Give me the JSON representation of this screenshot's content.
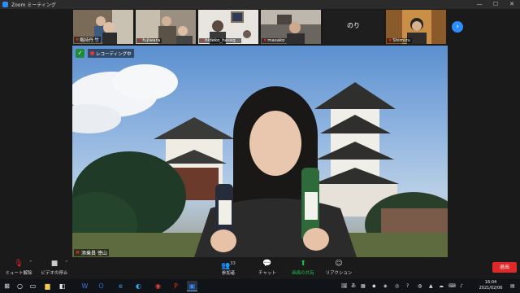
{
  "window": {
    "title": "Zoom ミーティング",
    "controls": {
      "minimize": "—",
      "maximize": "☐",
      "close": "✕"
    }
  },
  "thumbnails": [
    {
      "name": "剱持丹 竹",
      "muted": true
    },
    {
      "name": "fujiwara",
      "muted": true
    },
    {
      "name": "hideko_haseg...",
      "muted": true
    },
    {
      "name": "masako",
      "muted": true
    },
    {
      "name": "のり",
      "muted": false,
      "video_off": true
    },
    {
      "name": "Shimizu",
      "muted": true
    }
  ],
  "next_page_icon": "chevron-right-icon",
  "main_video": {
    "recording_label": "レコーディング中",
    "speaker_name": "添乗員 徳山",
    "speaker_muted": true
  },
  "toolbar": {
    "mute": "ミュート解除",
    "video": "ビデオの停止",
    "participants": "参加者",
    "participants_count": "33",
    "chat": "チャット",
    "share": "画面の共有",
    "reactions": "リアクション",
    "leave": "退出"
  },
  "taskbar": {
    "search_placeholder": "",
    "tray_ime": "あ",
    "time": "16:04",
    "date": "2021/02/06"
  },
  "colors": {
    "accent": "#2d8cff",
    "leave": "#e02828",
    "share": "#1fbf4a"
  }
}
